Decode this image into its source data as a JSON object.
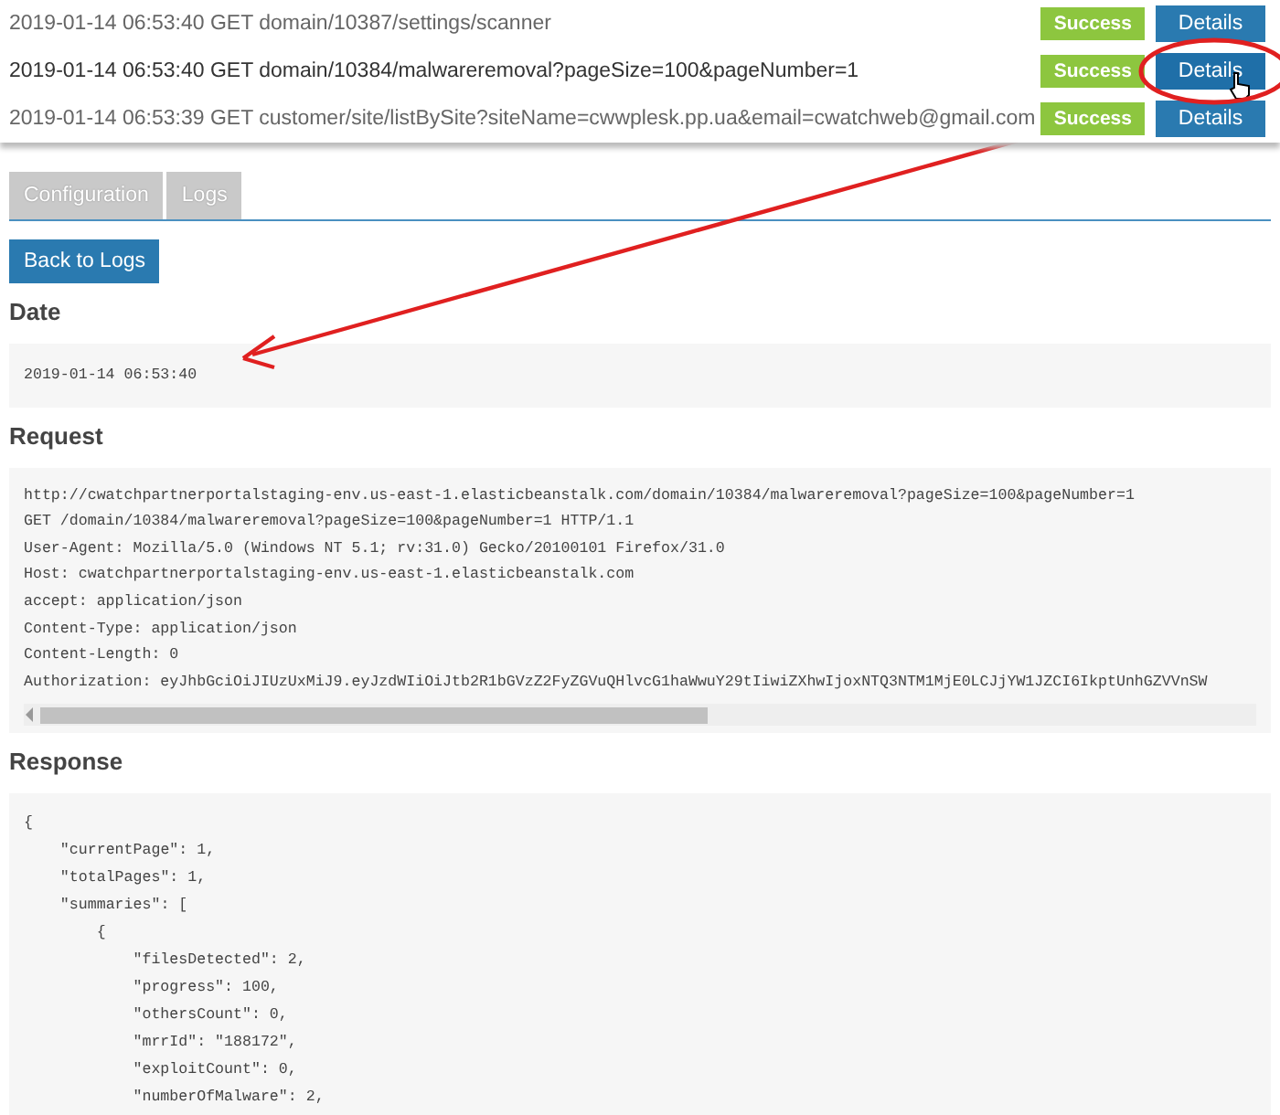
{
  "log_rows": [
    {
      "text": "2019-01-14 06:53:40 GET domain/10387/settings/scanner",
      "status": "Success",
      "button": "Details",
      "selected": false
    },
    {
      "text": "2019-01-14 06:53:40 GET domain/10384/malwareremoval?pageSize=100&pageNumber=1",
      "status": "Success",
      "button": "Details",
      "selected": true
    },
    {
      "text": "2019-01-14 06:53:39 GET customer/site/listBySite?siteName=cwwplesk.pp.ua&email=cwatchweb@gmail.com",
      "status": "Success",
      "button": "Details",
      "selected": false
    }
  ],
  "tabs": [
    {
      "label": "Configuration",
      "selected": false
    },
    {
      "label": "Logs",
      "selected": false
    }
  ],
  "back_button": "Back to Logs",
  "sections": [
    {
      "title": "Date",
      "kind": "plain",
      "lines": [
        "2019-01-14 06:53:40"
      ]
    },
    {
      "title": "Request",
      "kind": "scroll",
      "lines": [
        "http://cwatchpartnerportalstaging-env.us-east-1.elasticbeanstalk.com/domain/10384/malwareremoval?pageSize=100&pageNumber=1",
        "GET /domain/10384/malwareremoval?pageSize=100&pageNumber=1 HTTP/1.1",
        "User-Agent: Mozilla/5.0 (Windows NT 5.1; rv:31.0) Gecko/20100101 Firefox/31.0",
        "Host: cwatchpartnerportalstaging-env.us-east-1.elasticbeanstalk.com",
        "accept: application/json",
        "Content-Type: application/json",
        "Content-Length: 0",
        "Authorization: eyJhbGciOiJIUzUxMiJ9.eyJzdWIiOiJtb2R1bGVzZ2FyZGVuQHlvcG1haWwuY29tIiwiZXhwIjoxNTQ3NTM1MjE0LCJjYW1JZCI6IkptUnhGZVVnSW"
      ]
    },
    {
      "title": "Response",
      "kind": "plain",
      "lines": [
        "{",
        "    \"currentPage\": 1,",
        "    \"totalPages\": 1,",
        "    \"summaries\": [",
        "        {",
        "            \"filesDetected\": 2,",
        "            \"progress\": 100,",
        "            \"othersCount\": 0,",
        "            \"mrrId\": \"188172\",",
        "            \"exploitCount\": 0,",
        "            \"numberOfMalware\": 2,"
      ]
    }
  ]
}
